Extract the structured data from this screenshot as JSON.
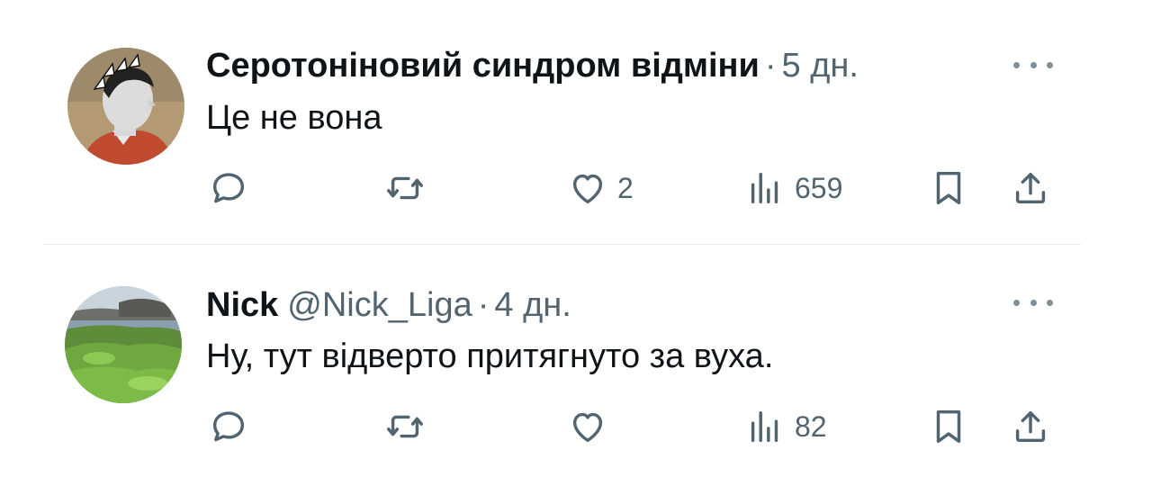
{
  "replies": [
    {
      "author_name": "Серотоніновий синдром відміни",
      "handle": "",
      "separator": "·",
      "time": "5 дн.",
      "text": "Це не вона",
      "reply_count": "",
      "repost_count": "",
      "like_count": "2",
      "view_count": "659",
      "avatar": "grayscale-profile-portrait-with-arrows"
    },
    {
      "author_name": "Nick",
      "handle": "@Nick_Liga",
      "separator": "·",
      "time": "4 дн.",
      "text": "Ну, тут відверто притягнуто за вуха.",
      "reply_count": "",
      "repost_count": "",
      "like_count": "",
      "view_count": "82",
      "avatar": "green-coastal-landscape"
    }
  ],
  "colors": {
    "text_primary": "#0f1419",
    "text_secondary": "#536471",
    "divider": "#e6e9ec",
    "background": "#ffffff"
  },
  "icons": [
    "reply-icon",
    "repost-icon",
    "like-icon",
    "views-icon",
    "bookmark-icon",
    "share-icon",
    "more-icon"
  ]
}
